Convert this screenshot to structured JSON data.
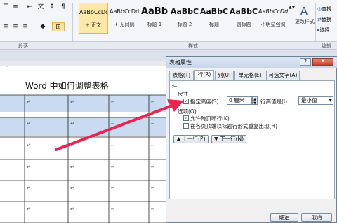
{
  "ribbon": {
    "groups": {
      "paragraph": "段落",
      "styles": "样式",
      "editing": "编辑"
    },
    "styles": [
      {
        "preview": "AaBbCcDd",
        "name": "+ 正文"
      },
      {
        "preview": "AaBbCcDd",
        "name": "+ 无间隔"
      },
      {
        "preview": "AaBb",
        "name": "标题 1"
      },
      {
        "preview": "AaBbC",
        "name": "标题 2"
      },
      {
        "preview": "AaBbC",
        "name": "标题"
      },
      {
        "preview": "AaBbC",
        "name": "副标题"
      },
      {
        "preview": "AaBbCcDd",
        "name": "不明显强调"
      }
    ],
    "change_styles": "更改样式",
    "find": "查找",
    "replace": "替换",
    "select": "选择"
  },
  "document": {
    "title": "Word 中如何调整表格",
    "cell_mark": "↵"
  },
  "dialog": {
    "title": "表格属性",
    "help": "?",
    "tabs": [
      "表格(T)",
      "行(R)",
      "列(U)",
      "单元格(E)",
      "可选文字(A)"
    ],
    "section_row": "行",
    "size_label": "尺寸",
    "specify_height": "指定高度(S):",
    "height_value": "0 厘米",
    "height_rule_label": "行高值是(I):",
    "height_rule_value": "最小值",
    "options_label": "选项(O)",
    "allow_break": "允许跨页断行(K)",
    "repeat_header": "在各页顶端以标题行形式重复出现(H)",
    "prev_row": "▲ 上一行(P)",
    "next_row": "▼ 下一行(N)",
    "ok": "确定",
    "cancel": "取消"
  },
  "colors": {
    "arrow": "#e8244f",
    "header_row": "#c9daf1",
    "dialog_title": "#c7d6ea"
  }
}
